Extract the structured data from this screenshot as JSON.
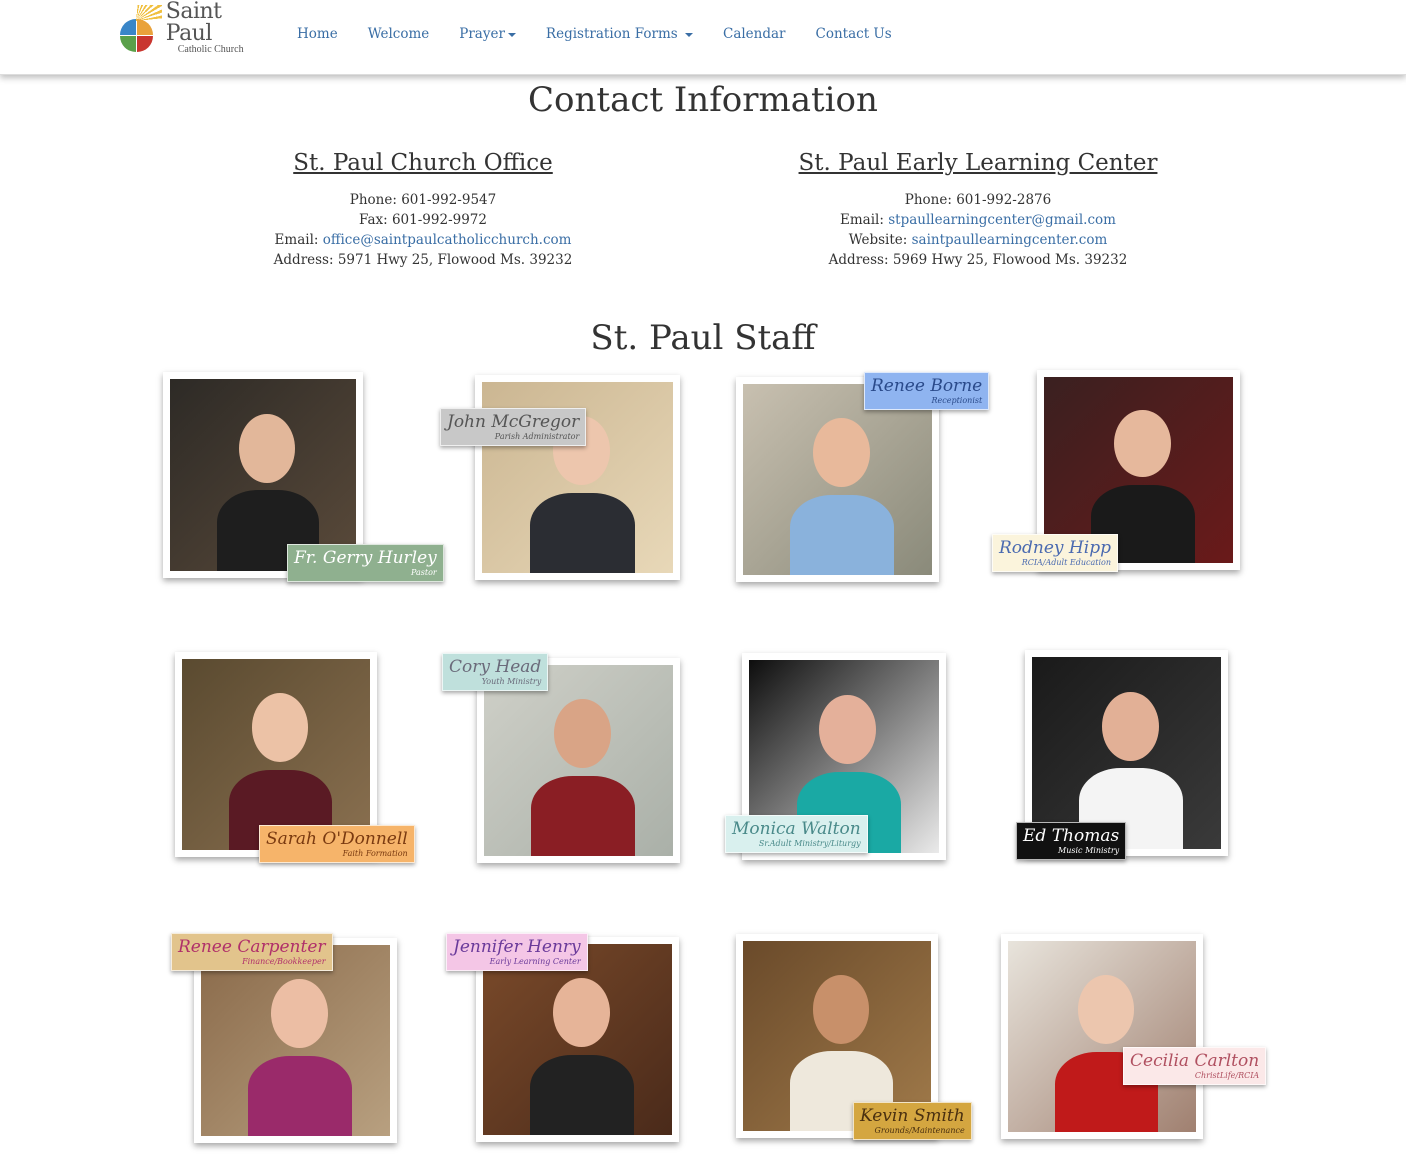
{
  "brand": {
    "title": "Saint Paul",
    "subtitle": "Catholic Church"
  },
  "nav": {
    "home": "Home",
    "welcome": "Welcome",
    "prayer": "Prayer",
    "registration": "Registration Forms",
    "calendar": "Calendar",
    "contact": "Contact Us"
  },
  "page_title": "Contact Information",
  "church_office": {
    "heading": "St. Paul Church Office",
    "phone": "Phone: 601-992-9547",
    "fax": "Fax: 601-992-9972",
    "email_label": "Email: ",
    "email": "office@saintpaulcatholicchurch.com",
    "address": "Address: 5971 Hwy 25, Flowood Ms. 39232"
  },
  "learning_center": {
    "heading": "St. Paul Early Learning Center",
    "phone": "Phone: 601-992-2876",
    "email_label": "Email: ",
    "email": "stpaullearningcenter@gmail.com",
    "website_label": "Website: ",
    "website": "saintpaullearningcenter.com",
    "address": "Address: 5969 Hwy 25, Flowood Ms. 39232"
  },
  "staff_title": "St. Paul Staff",
  "staff": [
    {
      "name": "Fr. Gerry Hurley",
      "role": "Pastor",
      "tag_color": "#8fb08f",
      "name_color": "#ffffff"
    },
    {
      "name": "John McGregor",
      "role": "Parish Administrator",
      "tag_color": "#c8c8c8",
      "name_color": "#555555"
    },
    {
      "name": "Renee Borne",
      "role": "Receptionist",
      "tag_color": "#8fb4f0",
      "name_color": "#2a4a8a"
    },
    {
      "name": "Rodney Hipp",
      "role": "RCIA/Adult Education",
      "tag_color": "#fbf4dc",
      "name_color": "#4a6ab0"
    },
    {
      "name": "Sarah O'Donnell",
      "role": "Faith Formation",
      "tag_color": "#f6b46a",
      "name_color": "#7a3a10"
    },
    {
      "name": "Cory Head",
      "role": "Youth Ministry",
      "tag_color": "#bfe0dc",
      "name_color": "#6a6a7a"
    },
    {
      "name": "Monica Walton",
      "role": "Sr.Adult Ministry/Liturgy",
      "tag_color": "#d9f0ee",
      "name_color": "#4a8a8a"
    },
    {
      "name": "Ed Thomas",
      "role": "Music Ministry",
      "tag_color": "#111111",
      "name_color": "#ffffff"
    },
    {
      "name": "Renee Carpenter",
      "role": "Finance/Bookkeeper",
      "tag_color": "#e2c48c",
      "name_color": "#b0306a"
    },
    {
      "name": "Jennifer Henry",
      "role": "Early Learning Center",
      "tag_color": "#f4c6e6",
      "name_color": "#6a3a9a"
    },
    {
      "name": "Kevin Smith",
      "role": "Grounds/Maintenance",
      "tag_color": "#d4a640",
      "name_color": "#4a3010"
    },
    {
      "name": "Cecilia Carlton",
      "role": "ChristLife/RCIA",
      "tag_color": "#fbe8e8",
      "name_color": "#b05060"
    }
  ]
}
